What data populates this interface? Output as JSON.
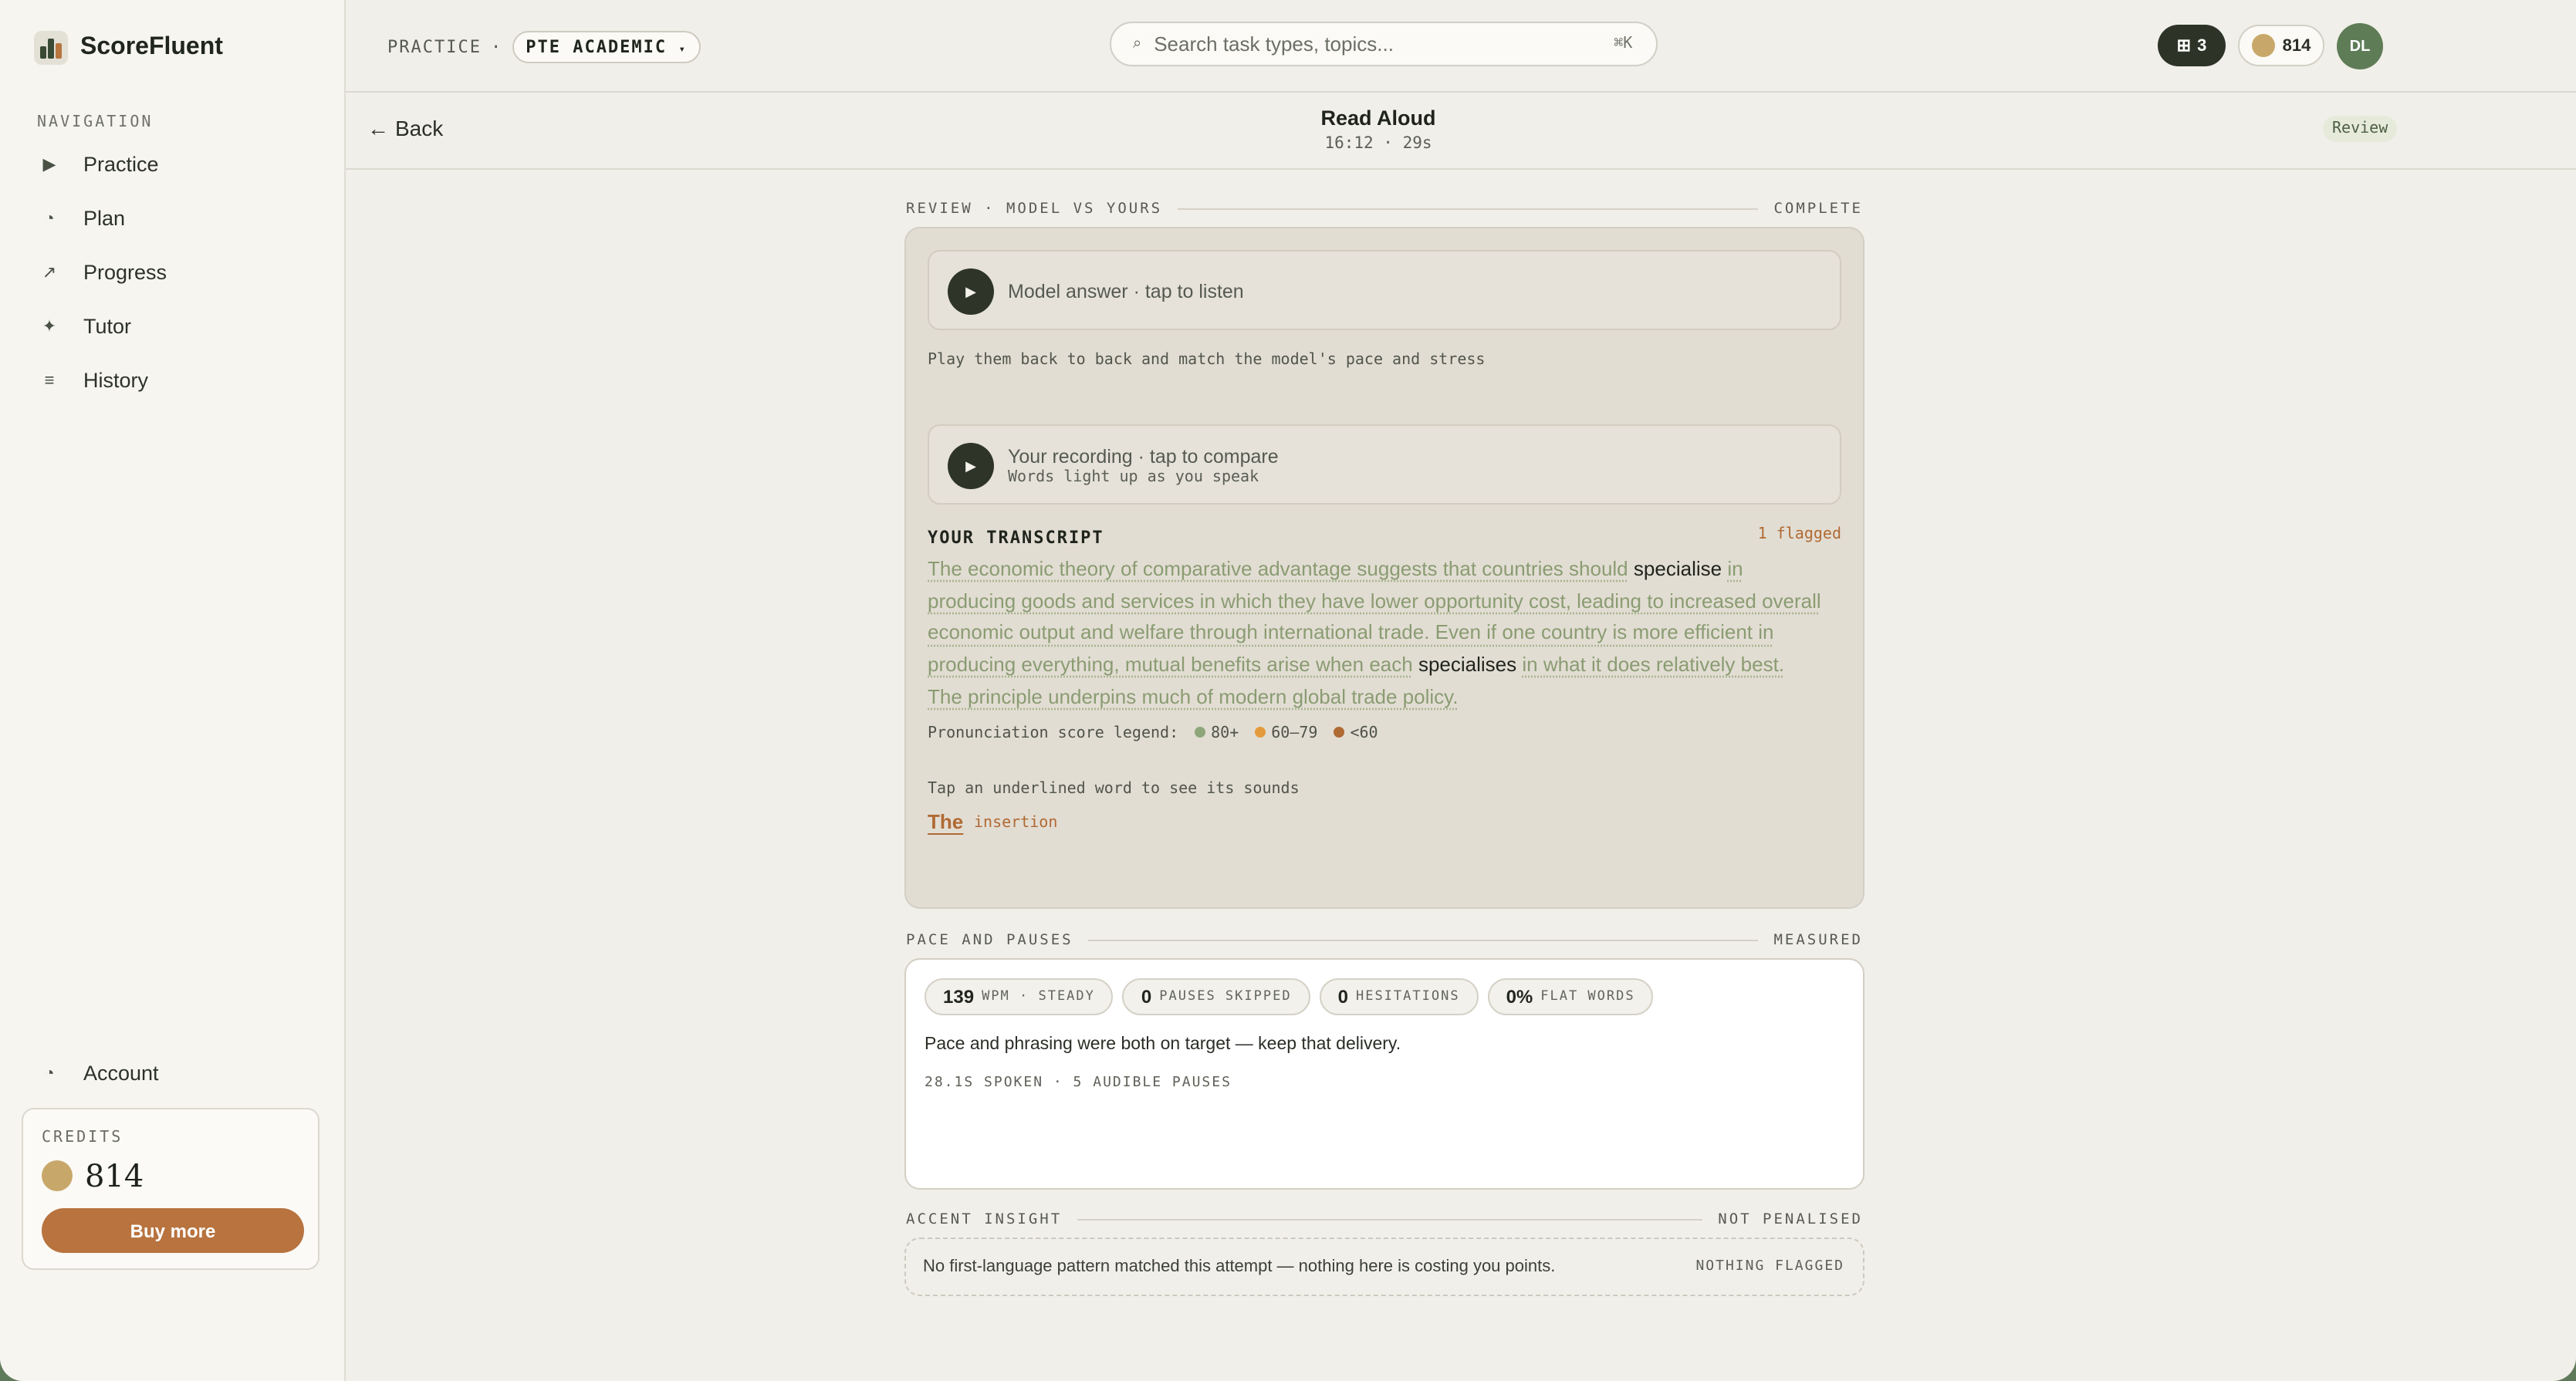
{
  "brand": {
    "name": "ScoreFluent"
  },
  "sidebar": {
    "heading": "NAVIGATION",
    "items": [
      {
        "label": "Practice",
        "icon": "play-icon"
      },
      {
        "label": "Plan",
        "icon": "pie-icon"
      },
      {
        "label": "Progress",
        "icon": "arrow-up-right-icon"
      },
      {
        "label": "Tutor",
        "icon": "sparkle-icon"
      },
      {
        "label": "History",
        "icon": "list-icon"
      }
    ],
    "account_label": "Account",
    "credits": {
      "label": "CREDITS",
      "value": "814",
      "buy_label": "Buy more"
    }
  },
  "topbar": {
    "breadcrumb_root": "PRACTICE",
    "breadcrumb_sep": "·",
    "exam": "PTE ACADEMIC",
    "exam_caret": "▾",
    "search_placeholder": "Search task types, topics...",
    "search_shortcut": "⌘K",
    "streak": "3",
    "credits": "814",
    "avatar": "DL"
  },
  "subheader": {
    "back_label": "Back",
    "title": "Read Aloud",
    "meta": "16:12 · 29s",
    "badge": "Review"
  },
  "review": {
    "section_label": "REVIEW · MODEL VS YOURS",
    "section_status": "COMPLETE",
    "model_label": "Model answer · tap to listen",
    "hint": "Play them back to back and match the model's pace and stress",
    "recording_label": "Your recording · tap to compare",
    "recording_sub": "Words light up as you speak",
    "transcript_heading": "YOUR TRANSCRIPT",
    "flagged": "1 flagged",
    "transcript": [
      {
        "text": "The economic theory of comparative advantage suggests that countries should",
        "scored": true
      },
      {
        "text": "specialise",
        "scored": false
      },
      {
        "text": "in producing goods and services in which they have lower opportunity cost, leading to increased overall economic output and welfare through international trade. Even if one country is more efficient in producing everything, mutual benefits arise when each",
        "scored": true
      },
      {
        "text": "specialises",
        "scored": false
      },
      {
        "text": "in what it does relatively best. The principle underpins much of modern global trade policy.",
        "scored": true
      }
    ],
    "legend": {
      "label": "Pronunciation score legend:",
      "items": [
        {
          "label": "80+",
          "color": "#8fa57a"
        },
        {
          "label": "60–79",
          "color": "#e39a3c"
        },
        {
          "label": "<60",
          "color": "#b06a34"
        }
      ]
    },
    "word_hint": "Tap an underlined word to see its sounds",
    "flagged_word": "The",
    "flagged_type": "insertion"
  },
  "pace": {
    "section_label": "PACE AND PAUSES",
    "section_status": "MEASURED",
    "stats": [
      {
        "value": "139",
        "label": "WPM · STEADY"
      },
      {
        "value": "0",
        "label": "PAUSES SKIPPED"
      },
      {
        "value": "0",
        "label": "HESITATIONS"
      },
      {
        "value": "0%",
        "label": "FLAT WORDS"
      }
    ],
    "message": "Pace and phrasing were both on target — keep that delivery.",
    "meta": "28.1S SPOKEN · 5 AUDIBLE PAUSES"
  },
  "accent": {
    "section_label": "ACCENT INSIGHT",
    "section_status": "NOT PENALISED",
    "message": "No first-language pattern matched this attempt — nothing here is costing you points.",
    "status": "NOTHING FLAGGED"
  }
}
